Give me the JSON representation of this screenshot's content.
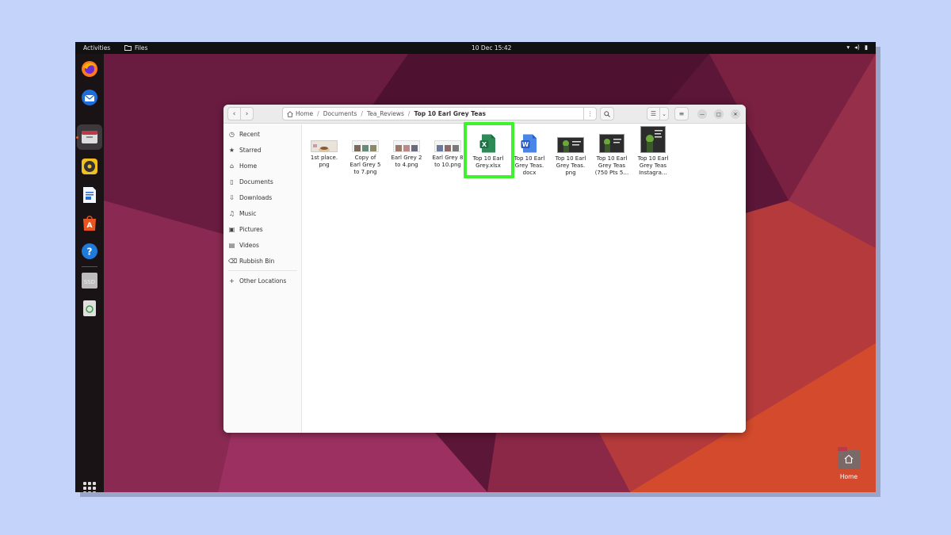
{
  "topbar": {
    "activities": "Activities",
    "app_name": "Files",
    "clock": "10 Dec  15:42"
  },
  "colors": {
    "accent_highlight": "#3ff22f",
    "ubuntu_orange": "#e95420",
    "excel_green": "#1e7145",
    "word_blue": "#2b5cbf"
  },
  "dock": {
    "items": [
      "firefox-icon",
      "thunderbird-icon",
      "files-icon",
      "rhythmbox-icon",
      "writer-icon",
      "app-center-icon",
      "help-icon",
      "ssd-drive-icon",
      "trash-icon"
    ],
    "ssd_label": "SSD"
  },
  "desktop": {
    "home_label": "Home"
  },
  "window": {
    "breadcrumb": {
      "home": "Home",
      "documents": "Documents",
      "tea_reviews": "Tea_Reviews",
      "current": "Top 10 Earl Grey Teas"
    }
  },
  "sidebar": {
    "items": [
      {
        "label": "Recent",
        "icon": "clock-icon"
      },
      {
        "label": "Starred",
        "icon": "star-icon"
      },
      {
        "label": "Home",
        "icon": "home-icon"
      },
      {
        "label": "Documents",
        "icon": "document-icon"
      },
      {
        "label": "Downloads",
        "icon": "download-icon"
      },
      {
        "label": "Music",
        "icon": "music-icon"
      },
      {
        "label": "Pictures",
        "icon": "picture-icon"
      },
      {
        "label": "Videos",
        "icon": "video-icon"
      },
      {
        "label": "Rubbish Bin",
        "icon": "trash-icon"
      }
    ],
    "other_locations": "Other Locations"
  },
  "files": [
    {
      "line1": "1st place.",
      "line2": "png",
      "line3": "",
      "type": "image"
    },
    {
      "line1": "Copy of",
      "line2": "Earl Grey 5",
      "line3": "to 7.png",
      "type": "image"
    },
    {
      "line1": "Earl Grey 2",
      "line2": "to 4.png",
      "line3": "",
      "type": "image"
    },
    {
      "line1": "Earl Grey 8",
      "line2": "to 10.png",
      "line3": "",
      "type": "image"
    },
    {
      "line1": "Top 10 Earl",
      "line2": "Grey.xlsx",
      "line3": "",
      "type": "xlsx",
      "icon_letter": "X"
    },
    {
      "line1": "Top 10 Earl",
      "line2": "Grey Teas.",
      "line3": "docx",
      "type": "docx",
      "icon_letter": "W"
    },
    {
      "line1": "Top 10 Earl",
      "line2": "Grey Teas.",
      "line3": "png",
      "type": "image"
    },
    {
      "line1": "Top 10 Earl",
      "line2": "Grey Teas",
      "line3": "(750 Pts 5…",
      "type": "image"
    },
    {
      "line1": "Top 10 Earl",
      "line2": "Grey Teas",
      "line3": "Instagra…",
      "type": "image"
    }
  ]
}
